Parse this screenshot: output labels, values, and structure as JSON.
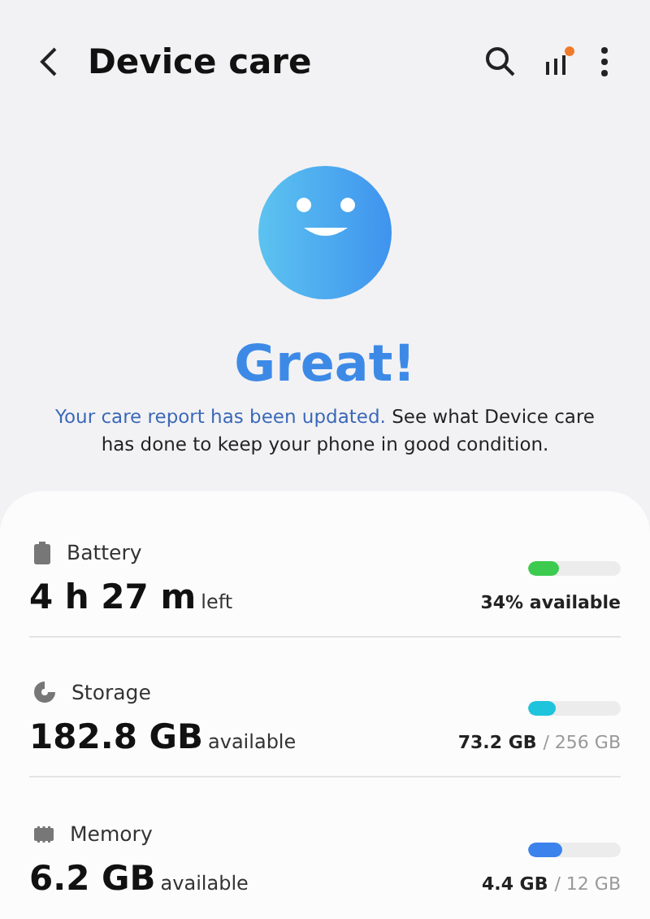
{
  "header": {
    "title": "Device care",
    "has_notification": true
  },
  "status": {
    "headline": "Great!",
    "link": "Your care report has been updated.",
    "text": "See what Device care has done to keep your phone in good condition."
  },
  "items": [
    {
      "kind": "battery",
      "label": "Battery",
      "value": "4 h 27 m",
      "unit": "left",
      "level": 0.34,
      "color": "#3ccb4e",
      "used": "34% available"
    },
    {
      "kind": "storage",
      "label": "Storage",
      "value": "182.8 GB",
      "unit": "available",
      "level": 0.29,
      "color": "#1ec3dc",
      "used": "73.2 GB",
      "total": "/ 256 GB"
    },
    {
      "kind": "memory",
      "label": "Memory",
      "value": "6.2 GB",
      "unit": "available",
      "level": 0.37,
      "color": "#3b82ec",
      "used": "4.4 GB",
      "total": "/ 12 GB"
    }
  ]
}
